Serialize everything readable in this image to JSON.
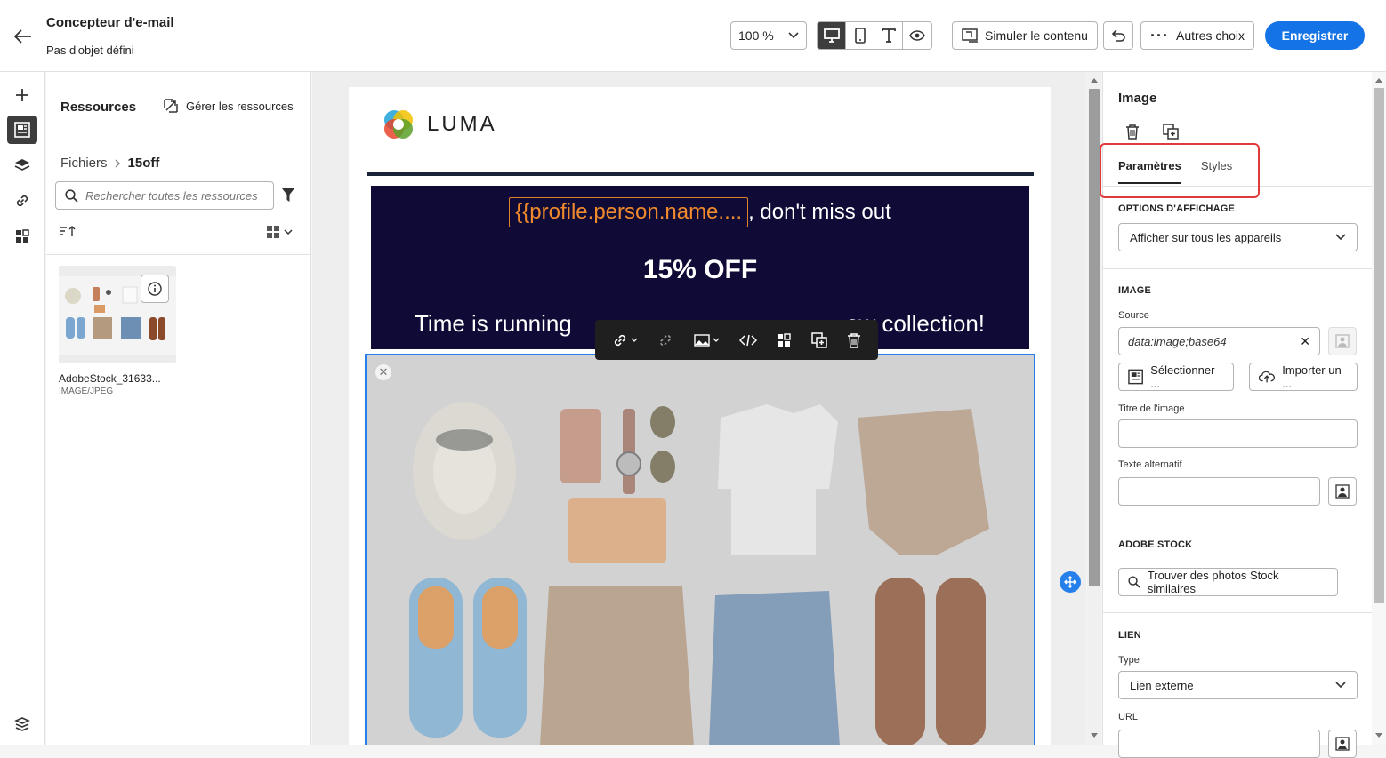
{
  "header": {
    "title": "Concepteur d'e-mail",
    "subtitle": "Pas d'objet défini",
    "zoom": "100 %",
    "simulate_label": "Simuler le contenu",
    "more_label": "Autres choix",
    "save_label": "Enregistrer",
    "view_modes": [
      "desktop-icon",
      "mobile-icon",
      "text-icon",
      "preview-eye-icon"
    ],
    "active_view": "desktop"
  },
  "rail": {
    "items": [
      "add-icon",
      "assets-icon",
      "layers-icon",
      "link-icon",
      "fragments-icon"
    ],
    "active": "assets",
    "bottom": "layer-tree-icon"
  },
  "resources": {
    "title": "Ressources",
    "manage_label": "Gérer les ressources",
    "breadcrumb": [
      "Fichiers",
      "15off"
    ],
    "search_placeholder": "Rechercher toutes les ressources",
    "asset": {
      "name": "AdobeStock_31633...",
      "type": "IMAGE/JPEG"
    }
  },
  "email": {
    "logo_text": "LUMA",
    "token": "{{profile.person.name....",
    "line1_suffix": ", don't miss out",
    "headline": "15% OFF",
    "line3_left": "Time is running",
    "line3_right": "ew collection!",
    "toolbar": [
      "link-icon",
      "unlink-icon",
      "image-icon",
      "code-icon",
      "layout-icon",
      "duplicate-icon",
      "delete-icon"
    ]
  },
  "props": {
    "title": "Image",
    "tabs": [
      "Paramètres",
      "Styles"
    ],
    "active_tab": "Paramètres",
    "display_options": {
      "heading": "OPTIONS D'AFFICHAGE",
      "value": "Afficher sur tous les appareils"
    },
    "image": {
      "heading": "IMAGE",
      "source_label": "Source",
      "source_value": "data:image;base64",
      "select_label": "Sélectionner ...",
      "import_label": "Importer un ...",
      "title_label": "Titre de l'image",
      "title_value": "",
      "alt_label": "Texte alternatif",
      "alt_value": ""
    },
    "stock": {
      "heading": "ADOBE STOCK",
      "find_label": "Trouver des photos Stock similaires"
    },
    "link": {
      "heading": "LIEN",
      "type_label": "Type",
      "type_value": "Lien externe",
      "url_label": "URL"
    }
  },
  "colors": {
    "accent": "#1473e6",
    "selection": "#2680eb",
    "banner_bg": "#0f0b36",
    "token": "#f08a2c",
    "highlight": "#e03a3a"
  }
}
